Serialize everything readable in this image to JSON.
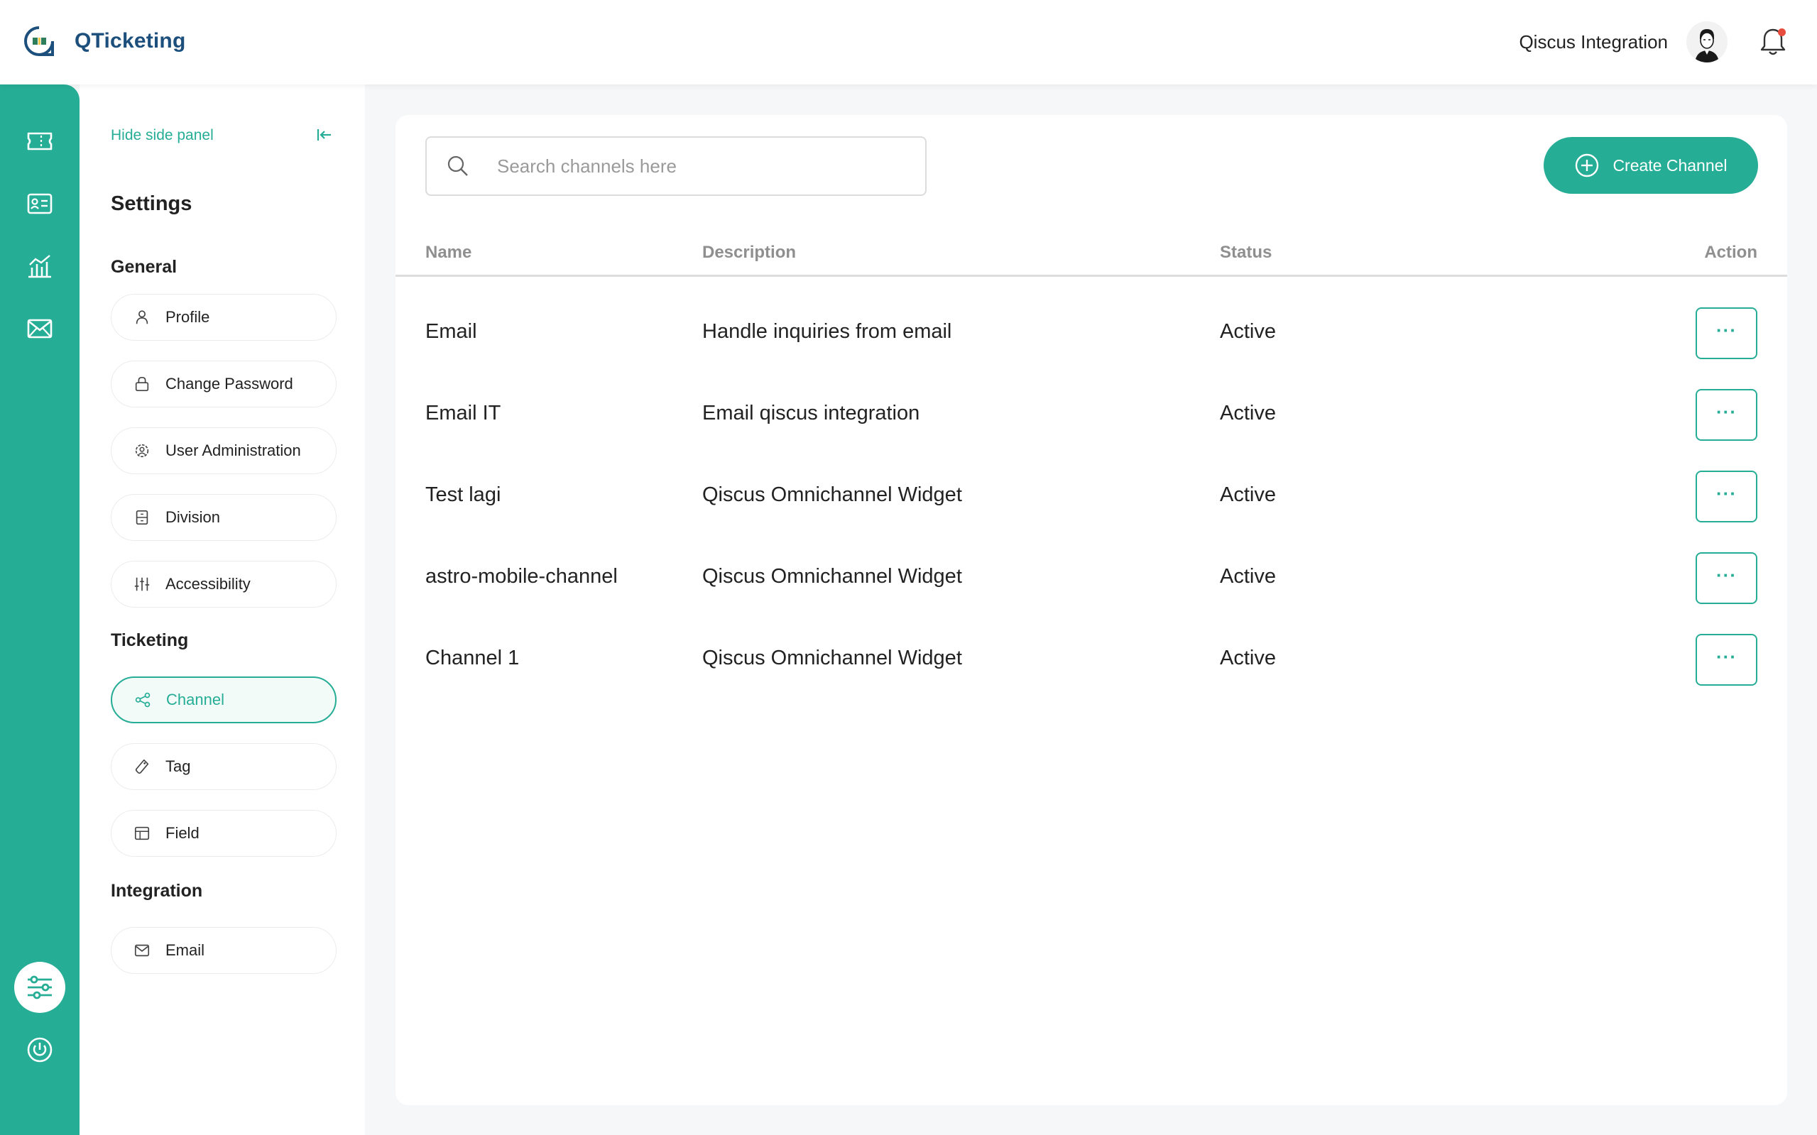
{
  "app": {
    "name": "QTicketing"
  },
  "header": {
    "user_name": "Qiscus Integration"
  },
  "rail": {
    "items": [
      {
        "icon": "ticket-icon"
      },
      {
        "icon": "contact-card-icon"
      },
      {
        "icon": "analytics-chart-icon"
      },
      {
        "icon": "mail-icon"
      },
      {
        "icon": "settings-sliders-icon",
        "active": true
      },
      {
        "icon": "power-icon"
      }
    ]
  },
  "sidepanel": {
    "hide_label": "Hide side panel",
    "title": "Settings",
    "sections": [
      {
        "label": "General",
        "items": [
          {
            "label": "Profile",
            "icon": "user-icon"
          },
          {
            "label": "Change Password",
            "icon": "lock-icon"
          },
          {
            "label": "User Administration",
            "icon": "user-gear-icon"
          },
          {
            "label": "Division",
            "icon": "division-icon"
          },
          {
            "label": "Accessibility",
            "icon": "sliders-icon"
          }
        ]
      },
      {
        "label": "Ticketing",
        "items": [
          {
            "label": "Channel",
            "icon": "share-icon",
            "active": true
          },
          {
            "label": "Tag",
            "icon": "tag-icon"
          },
          {
            "label": "Field",
            "icon": "layout-icon"
          }
        ]
      },
      {
        "label": "Integration",
        "items": [
          {
            "label": "Email",
            "icon": "envelope-icon"
          }
        ]
      }
    ]
  },
  "main": {
    "search_placeholder": "Search channels here",
    "create_label": "Create Channel",
    "columns": {
      "name": "Name",
      "description": "Description",
      "status": "Status",
      "action": "Action"
    },
    "rows": [
      {
        "name": "Email",
        "description": "Handle inquiries from email",
        "status": "Active",
        "action": "···"
      },
      {
        "name": "Email IT",
        "description": "Email qiscus integration",
        "status": "Active",
        "action": "···"
      },
      {
        "name": "Test lagi",
        "description": "Qiscus Omnichannel Widget",
        "status": "Active",
        "action": "···"
      },
      {
        "name": "astro-mobile-channel",
        "description": "Qiscus Omnichannel Widget",
        "status": "Active",
        "action": "···"
      },
      {
        "name": "Channel 1",
        "description": "Qiscus Omnichannel Widget",
        "status": "Active",
        "action": "···"
      }
    ]
  },
  "colors": {
    "accent": "#26ad96",
    "brand_text": "#1d4f7c",
    "notification": "#e74c3c"
  }
}
